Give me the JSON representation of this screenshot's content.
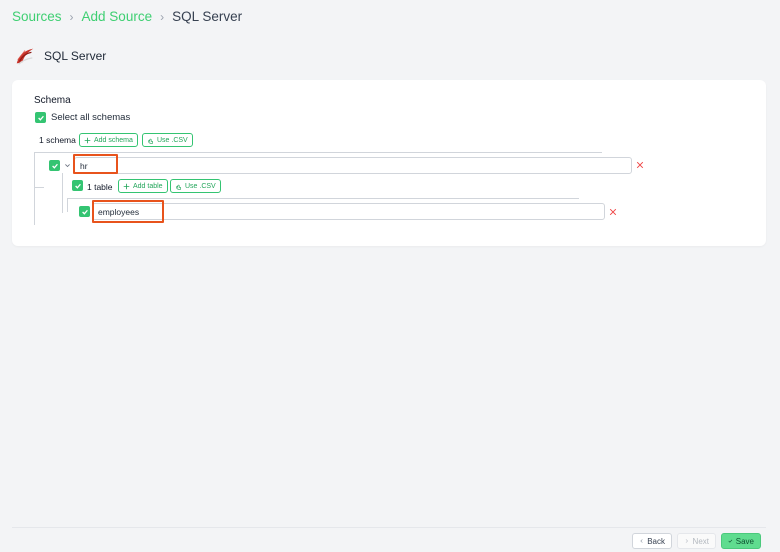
{
  "breadcrumb": {
    "items": [
      "Sources",
      "Add Source",
      "SQL Server"
    ],
    "separator": ">"
  },
  "source": {
    "title": "SQL Server",
    "logo_icon": "sql-server-logo-icon"
  },
  "schema_section": {
    "label": "Schema",
    "select_all_label": "Select all schemas",
    "select_all_checked": true,
    "count_label": "1 schema",
    "add_schema_label": "Add schema",
    "use_csv_label": "Use .CSV",
    "schemas": [
      {
        "name": "hr",
        "checked": true,
        "expanded": true,
        "table_count_label": "1 table",
        "add_table_label": "Add table",
        "use_csv_label": "Use .CSV",
        "tables": [
          {
            "name": "employees",
            "checked": true
          }
        ]
      }
    ]
  },
  "footer": {
    "back_label": "Back",
    "next_label": "Next",
    "save_label": "Save"
  },
  "colors": {
    "accent_green": "#34c472",
    "breadcrumb_link": "#3ecf72",
    "highlight_orange": "#e8531c",
    "remove_red": "#ef4444"
  }
}
